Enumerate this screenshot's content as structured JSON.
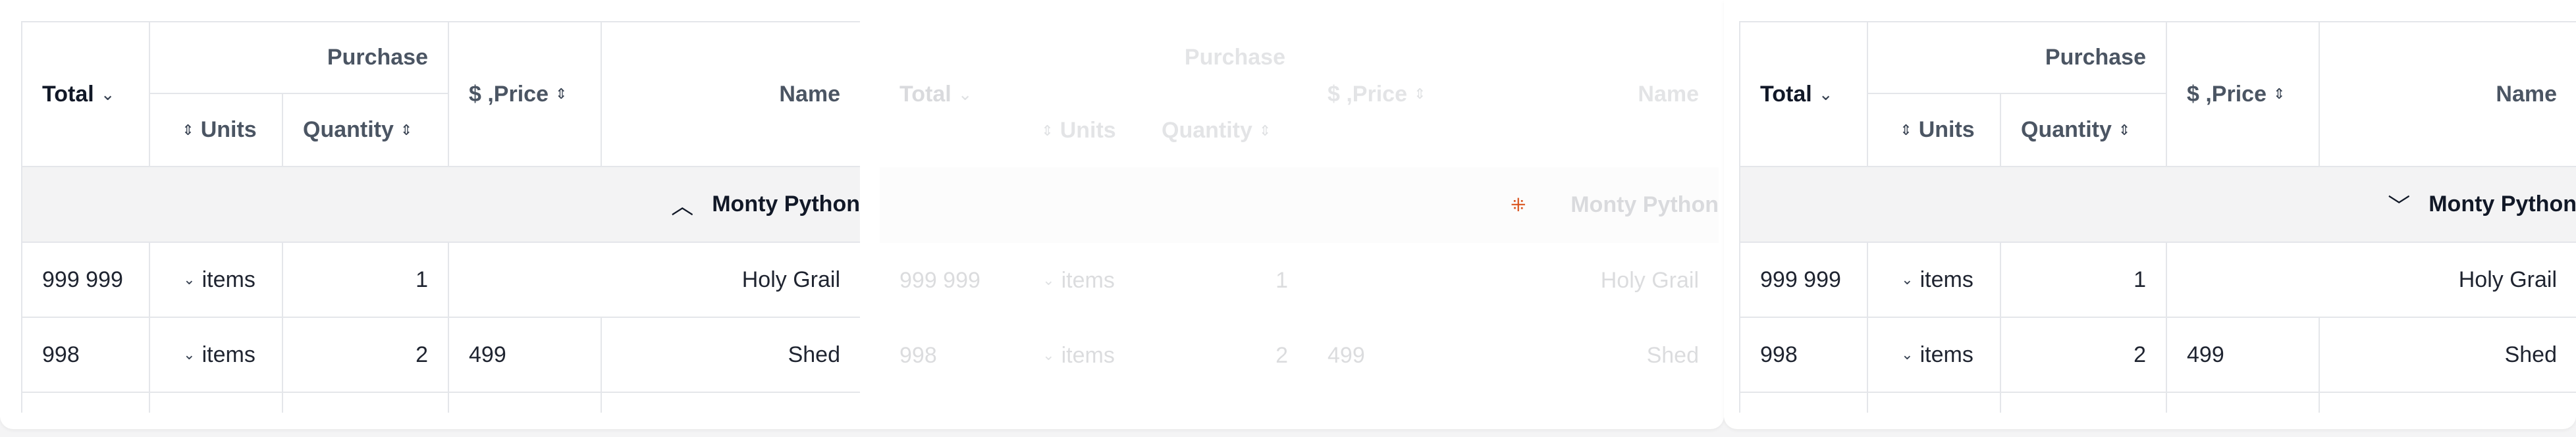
{
  "tables": [
    {
      "variant": "active",
      "headers": {
        "total": "Total",
        "purchase_group": "Purchase",
        "units": "Units",
        "quantity": "Quantity",
        "price": "$ ,Price",
        "name": "Name"
      },
      "icons": {
        "total_sort": "chevron-down-icon",
        "units_sort": "sort-icon",
        "quantity_sort": "sort-icon",
        "price_sort": "sort-icon",
        "group_toggle": "chevron-up-icon"
      },
      "group_label": "Monty Python",
      "rows": [
        {
          "total": "999 999",
          "units": "items",
          "quantity": "1",
          "price": "",
          "name": "Holy Grail"
        },
        {
          "total": "998",
          "units": "items",
          "quantity": "2",
          "price": "499",
          "name": "Shed"
        }
      ]
    },
    {
      "variant": "dragging",
      "headers": {
        "total": "Total",
        "purchase_group": "Purchase",
        "units": "Units",
        "quantity": "Quantity",
        "price": "$ ,Price",
        "name": "Name"
      },
      "icons": {
        "group_toggle": "drag-handle-icon"
      },
      "group_label": "Monty Python",
      "rows": [
        {
          "total": "999 999",
          "units": "items",
          "quantity": "1",
          "price": "",
          "name": "Holy Grail"
        },
        {
          "total": "998",
          "units": "items",
          "quantity": "2",
          "price": "499",
          "name": "Shed"
        }
      ]
    },
    {
      "variant": "collapsed",
      "headers": {
        "total": "Total",
        "purchase_group": "Purchase",
        "units": "Units",
        "quantity": "Quantity",
        "price": "$ ,Price",
        "name": "Name"
      },
      "icons": {
        "group_toggle": "chevron-down-icon"
      },
      "group_label": "Monty Python",
      "rows": [
        {
          "total": "999 999",
          "units": "items",
          "quantity": "1",
          "price": "",
          "name": "Holy Grail"
        },
        {
          "total": "998",
          "units": "items",
          "quantity": "2",
          "price": "499",
          "name": "Shed"
        }
      ]
    }
  ],
  "colors": {
    "border": "#e4e6ea",
    "group_bg": "#f3f3f4",
    "header_text": "#4b5563",
    "body_text": "#1f2430",
    "drag_icon": "#d9541e"
  }
}
